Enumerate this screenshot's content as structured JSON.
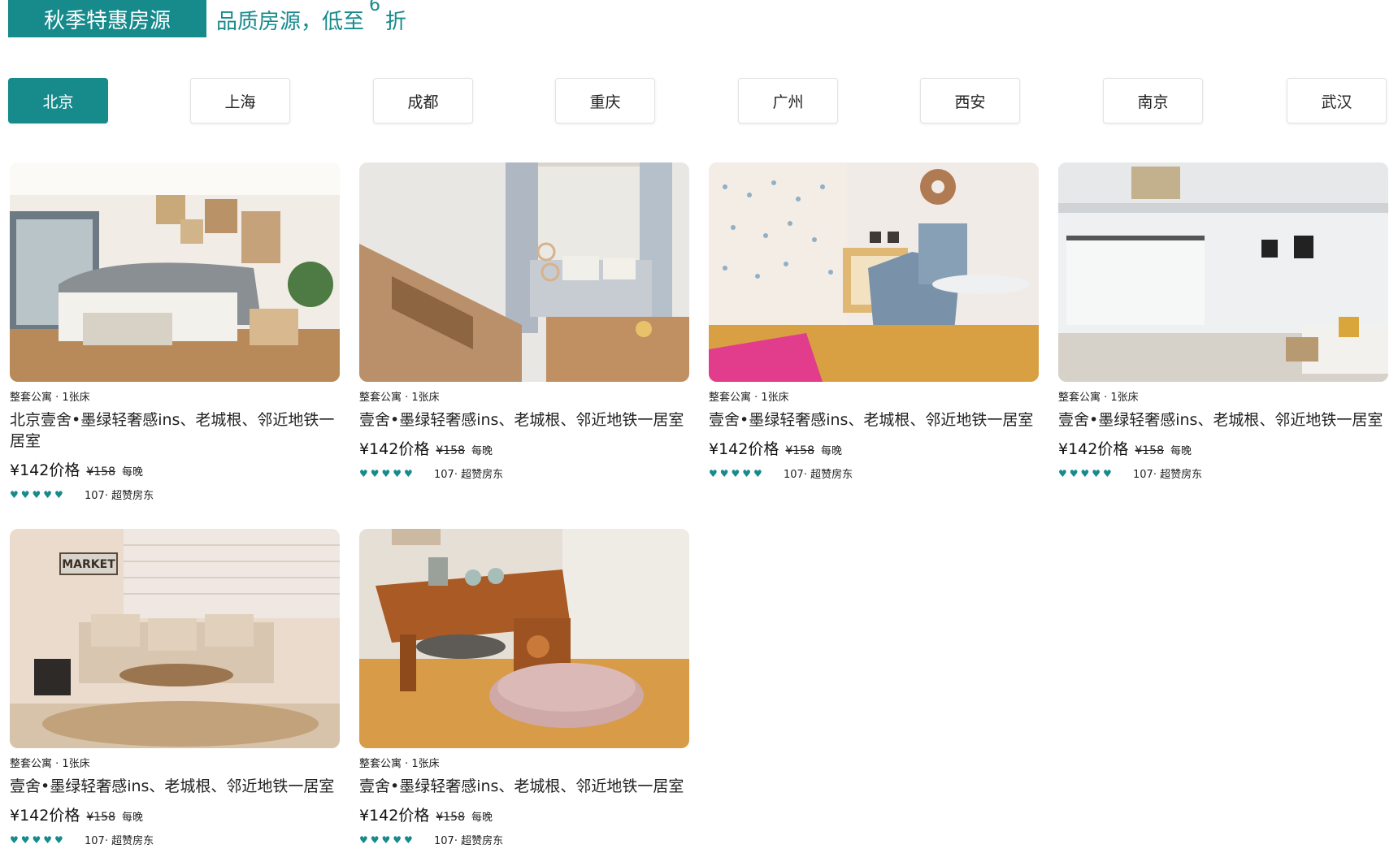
{
  "header": {
    "badge": "秋季特惠房源",
    "tagline_prefix": "品质房源，低至",
    "tagline_num": "6",
    "tagline_suffix": "折"
  },
  "tabs": [
    {
      "label": "北京",
      "active": true
    },
    {
      "label": "上海",
      "active": false
    },
    {
      "label": "成都",
      "active": false
    },
    {
      "label": "重庆",
      "active": false
    },
    {
      "label": "广州",
      "active": false
    },
    {
      "label": "西安",
      "active": false
    },
    {
      "label": "南京",
      "active": false
    },
    {
      "label": "武汉",
      "active": false
    }
  ],
  "listings": [
    {
      "meta": "整套公寓 · 1张床",
      "title": "北京壹舍•墨绿轻奢感ins、老城根、邻近地铁一居室",
      "price": "¥142价格",
      "original": "¥158",
      "per": "每晚",
      "hearts": "♥♥♥♥♥",
      "rating_text": "107· 超赞房东",
      "image": "bedroom"
    },
    {
      "meta": "整套公寓 · 1张床",
      "title": "壹舍•墨绿轻奢感ins、老城根、邻近地铁一居室",
      "price": "¥142价格",
      "original": "¥158",
      "per": "每晚",
      "hearts": "♥♥♥♥♥",
      "rating_text": "107· 超赞房东",
      "image": "stairs"
    },
    {
      "meta": "整套公寓 · 1张床",
      "title": "壹舍•墨绿轻奢感ins、老城根、邻近地铁一居室",
      "price": "¥142价格",
      "original": "¥158",
      "per": "每晚",
      "hearts": "♥♥♥♥♥",
      "rating_text": "107· 超赞房东",
      "image": "chair"
    },
    {
      "meta": "整套公寓 · 1张床",
      "title": "壹舍•墨绿轻奢感ins、老城根、邻近地铁一居室",
      "price": "¥142价格",
      "original": "¥158",
      "per": "每晚",
      "hearts": "♥♥♥♥♥",
      "rating_text": "107· 超赞房东",
      "image": "loft"
    },
    {
      "meta": "整套公寓 · 1张床",
      "title": "壹舍•墨绿轻奢感ins、老城根、邻近地铁一居室",
      "price": "¥142价格",
      "original": "¥158",
      "per": "每晚",
      "hearts": "♥♥♥♥♥",
      "rating_text": "107· 超赞房东",
      "image": "sofa",
      "sign": "MARKET"
    },
    {
      "meta": "整套公寓 · 1张床",
      "title": "壹舍•墨绿轻奢感ins、老城根、邻近地铁一居室",
      "price": "¥142价格",
      "original": "¥158",
      "per": "每晚",
      "hearts": "♥♥♥♥♥",
      "rating_text": "107· 超赞房东",
      "image": "table"
    }
  ]
}
